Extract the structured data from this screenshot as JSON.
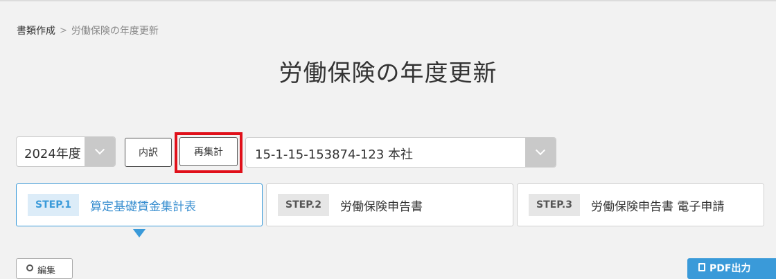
{
  "breadcrumb": {
    "parent": "書類作成",
    "separator": ">",
    "current": "労働保険の年度更新"
  },
  "page_title": "労働保険の年度更新",
  "controls": {
    "year_select_value": "2024年度",
    "breakdown_label": "内訳",
    "recalc_label": "再集計",
    "office_select_value": "15-1-15-153874-123 本社"
  },
  "steps": [
    {
      "badge": "STEP.1",
      "label": "算定基礎賃金集計表",
      "active": true
    },
    {
      "badge": "STEP.2",
      "label": "労働保険申告書",
      "active": false
    },
    {
      "badge": "STEP.3",
      "label": "労働保険申告書 電子申請",
      "active": false
    }
  ],
  "actions": {
    "edit_label": "編集",
    "pdf_label": "PDF出力"
  },
  "colors": {
    "accent": "#3a9ad9",
    "highlight": "#e0101a",
    "background": "#f2f2f2"
  },
  "icons": [
    "chevron-down-icon",
    "chevron-right-icon",
    "gear-icon",
    "document-icon"
  ]
}
